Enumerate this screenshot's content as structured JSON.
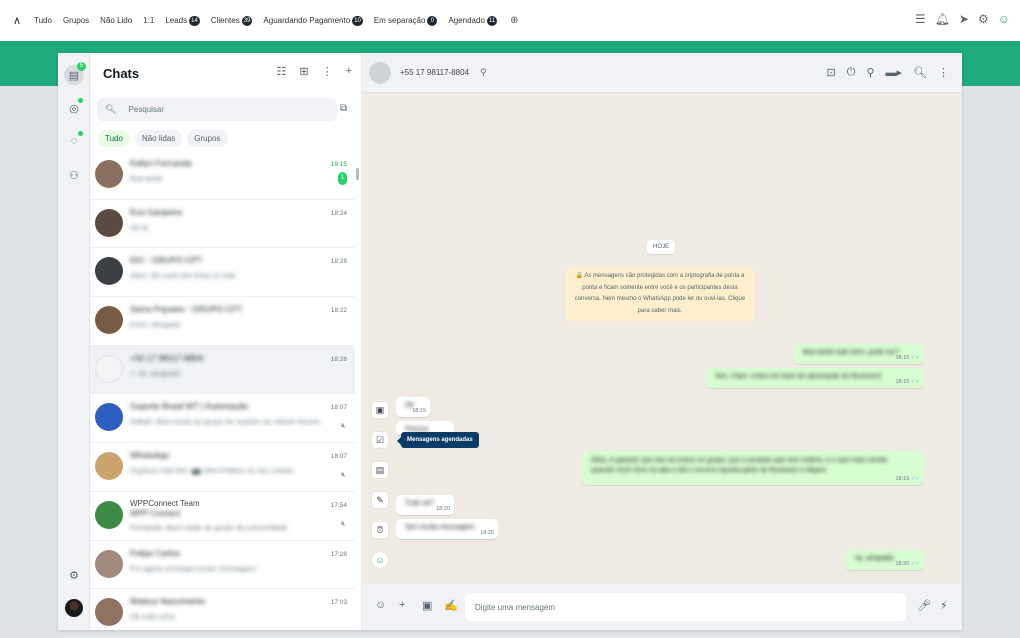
{
  "topbar": {
    "tags": [
      {
        "label": "Tudo",
        "count": ""
      },
      {
        "label": "Grupos",
        "count": ""
      },
      {
        "label": "Não Lido",
        "count": ""
      },
      {
        "label": "1:1",
        "count": ""
      },
      {
        "label": "Leads",
        "count": "14"
      },
      {
        "label": "Clientes",
        "count": "39"
      },
      {
        "label": "Aguardando Pagamento",
        "count": "10"
      },
      {
        "label": "Em separação",
        "count": "0"
      },
      {
        "label": "Agendado",
        "count": "11"
      }
    ],
    "right_icons": [
      "menu-icon",
      "bell-icon",
      "send-icon",
      "settings-icon",
      "profile-icon"
    ]
  },
  "rail": {
    "chats_badge": "5",
    "icons": [
      "chats-icon",
      "status-icon",
      "channels-icon",
      "communities-icon",
      "settings-icon",
      "avatar"
    ]
  },
  "chatlist": {
    "title": "Chats",
    "search_placeholder": "Pesquisar",
    "filters": [
      "Tudo",
      "Não lidas",
      "Grupos"
    ],
    "rows": [
      {
        "name": "Kellyn Fernanda",
        "preview": "Boa tarde",
        "time": "19:15",
        "unread": "1",
        "avatar_color": "#8a6f5f",
        "muted": false,
        "highlight": false
      },
      {
        "name": "Eva Ganpeira",
        "preview": "Ok tá",
        "time": "18:24",
        "unread": "",
        "avatar_color": "#5a4a42",
        "muted": false,
        "highlight": false
      },
      {
        "name": "DIV - GRUPO CPT",
        "preview": "Alice: Ok você tem linha no hub",
        "time": "18:28",
        "unread": "",
        "avatar_color": "#3c3f44",
        "muted": false,
        "highlight": false
      },
      {
        "name": "Sams Paywire - GRUPO CPT",
        "preview": "Erico: obrigado",
        "time": "18:22",
        "unread": "",
        "avatar_color": "#7a5c45",
        "muted": false,
        "highlight": false
      },
      {
        "name": "+55 17 98117-8804",
        "preview": "✓ ok, atrapado",
        "time": "18:28",
        "unread": "",
        "avatar_color": "#f3f4f5",
        "muted": false,
        "highlight": true
      },
      {
        "name": "Suporte Brasil WT | Automação",
        "preview": "Rafael: Bem-vindo ao grupo de suporte ao cliente Wcomdo",
        "time": "18:07",
        "unread": "",
        "avatar_color": "#2d5ec2",
        "muted": true,
        "highlight": false
      },
      {
        "name": "WhatsApp",
        "preview": "Duplicar Fale Bot: 📷 WIN Publico no seu celular",
        "time": "18:07",
        "unread": "",
        "avatar_color": "#c9a46c",
        "muted": true,
        "highlight": false
      },
      {
        "name": "WPP Connect",
        "sender": "WPPConnect Team",
        "preview": "Fernanda: Bem-vindo ao grupo da comunidade",
        "time": "17:54",
        "unread": "",
        "avatar_color": "#3b8a45",
        "muted": true,
        "highlight": false
      },
      {
        "name": "Felipe Carlos",
        "preview": "Fm agora consegui enviar mensagem",
        "time": "17:28",
        "unread": "",
        "avatar_color": "#a08a7c",
        "muted": false,
        "highlight": false
      },
      {
        "name": "Mateus Nascimento",
        "preview": "Ok tudo certo",
        "time": "17:03",
        "unread": "",
        "avatar_color": "#8f7261",
        "muted": false,
        "highlight": false
      }
    ]
  },
  "chat": {
    "phone": "+55 17 98117-8804",
    "header_icons": [
      "chat-folder-icon",
      "power-icon",
      "pin-icon",
      "video-call-icon",
      "search-icon",
      "menu-icon"
    ],
    "date_chip": "HOJE",
    "e2e_notice": "🔒 As mensagens são protegidas com a criptografia de ponta a ponta e ficam somente entre você e os participantes desta conversa. Nem mesmo o WhatsApp pode ler ou ouvi-las. Clique para saber mais.",
    "messages": [
      {
        "dir": "out",
        "text": "Boa tarde tudo bem, pode ser?",
        "time": "18:15"
      },
      {
        "dir": "out",
        "text": "Sim, Claro, estou em fase de aprovação do Business!",
        "time": "18:15"
      },
      {
        "dir": "in",
        "text": "Ok",
        "time": "18:15"
      },
      {
        "dir": "in",
        "text": "Preciso",
        "time": ""
      },
      {
        "dir": "out",
        "text": "Olha, é garantir que ela vai entrar no grupo, que o produto que tem melhor, é o que mais vende, quando você clica na aba e dá o recurso aquela parte do Business e depois",
        "time": "18:16"
      },
      {
        "dir": "in",
        "text": "Tudo ok?",
        "time": "18:20"
      },
      {
        "dir": "in",
        "text": "Sim recebi mensagem",
        "time": "18:20"
      },
      {
        "dir": "out",
        "text": "ok, atrapado",
        "time": "18:20"
      }
    ],
    "tooltip": "Mensagens agendadas",
    "side_icons": [
      "contact-card-icon",
      "checklist-icon",
      "scheduled-messages-icon",
      "edit-icon",
      "alarm-icon",
      "bot-icon"
    ],
    "composer_placeholder": "Digite uma mensagem"
  }
}
